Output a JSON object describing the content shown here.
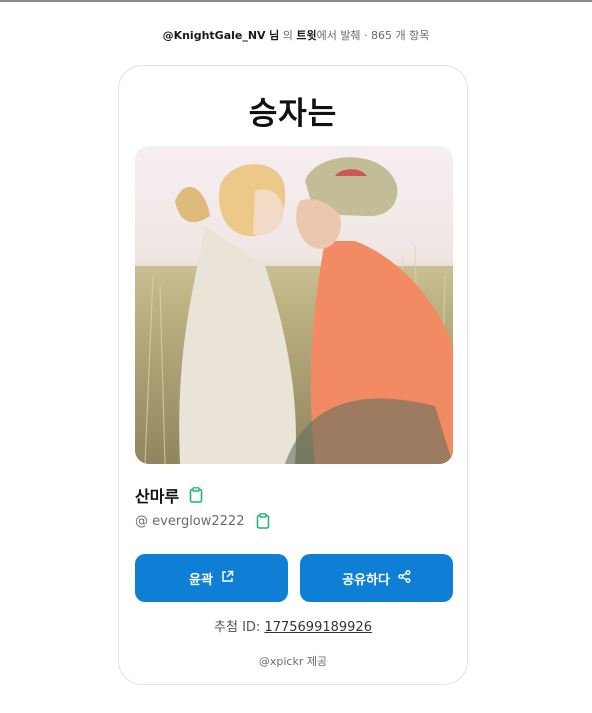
{
  "header": {
    "handle": "@KnightGale_NV",
    "honorific": "님",
    "particle": "의",
    "tweet_label": "트윗",
    "suffix": "에서 발췌 · 865 개 항목"
  },
  "card": {
    "title": "승자는",
    "photo_alt": "couple sitting in tall grass",
    "name": "산마루",
    "handle": "@ everglow2222",
    "open_button_label": "윤곽",
    "share_button_label": "공유하다",
    "rec_label": "추첨 ID:",
    "rec_id": "1775699189926",
    "provided_by": "@xpickr 제공"
  },
  "colors": {
    "accent": "#0f7fd6",
    "clipboard": "#22b573"
  },
  "icons": {
    "clipboard": "clipboard-icon",
    "external": "external-link-icon",
    "share": "share-icon"
  }
}
